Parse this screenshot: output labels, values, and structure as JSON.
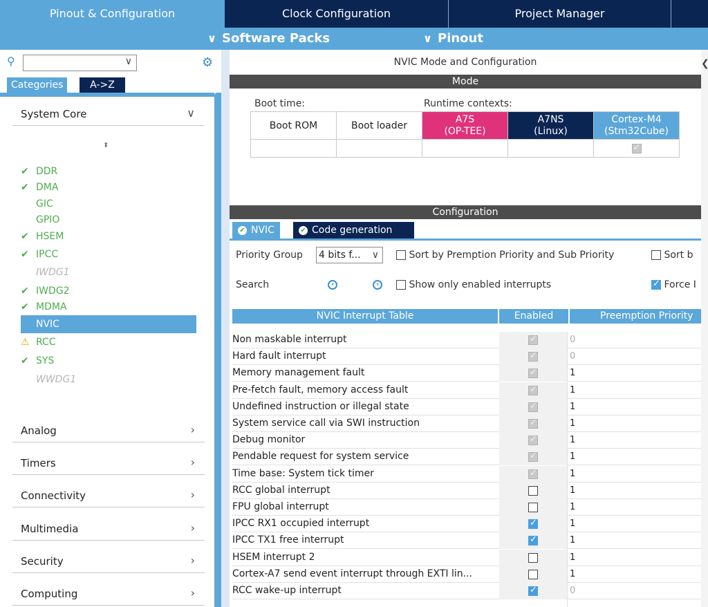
{
  "top_tabs": [
    "Pinout & Configuration",
    "Clock Configuration",
    "Project Manager"
  ],
  "sub_menu": [
    "Software Packs",
    "Pinout"
  ],
  "left": {
    "search_value": "",
    "tabs": [
      "Categories",
      "A->Z"
    ],
    "system_core": "System Core",
    "items": [
      {
        "label": "DDR",
        "state": "ok"
      },
      {
        "label": "DMA",
        "state": "ok"
      },
      {
        "label": "GIC",
        "state": "plain"
      },
      {
        "label": "GPIO",
        "state": "plain"
      },
      {
        "label": "HSEM",
        "state": "ok"
      },
      {
        "label": "IPCC",
        "state": "ok"
      },
      {
        "label": "IWDG1",
        "state": "disabled"
      },
      {
        "label": "IWDG2",
        "state": "ok"
      },
      {
        "label": "MDMA",
        "state": "ok"
      },
      {
        "label": "NVIC",
        "state": "selected"
      },
      {
        "label": "RCC",
        "state": "warning"
      },
      {
        "label": "SYS",
        "state": "ok"
      },
      {
        "label": "WWDG1",
        "state": "disabled"
      }
    ],
    "sections": [
      "Analog",
      "Timers",
      "Connectivity",
      "Multimedia",
      "Security",
      "Computing"
    ]
  },
  "right": {
    "title": "NVIC Mode and Configuration",
    "mode_bar": "Mode",
    "boot_time": "Boot time:",
    "runtime_contexts": "Runtime contexts:",
    "boot_rom": "Boot ROM",
    "boot_loader": "Boot loader",
    "a7s": "A7S",
    "a7s_sub": "(OP-TEE)",
    "a7ns": "A7NS",
    "a7ns_sub": "(Linux)",
    "m4": "Cortex-M4",
    "m4_sub": "(Stm32Cube)",
    "config_bar": "Configuration",
    "tab_nvic": "NVIC",
    "tab_codegen": "Code generation",
    "priority_group_label": "Priority Group",
    "priority_group_value": "4 bits f...",
    "sort_label": "Sort by Premption Priority and Sub Priority",
    "sort2_label": "Sort b",
    "search_label": "Search",
    "show_enabled_label": "Show only enabled interrupts",
    "force_label": "Force I",
    "col_table": "NVIC Interrupt Table",
    "col_enabled": "Enabled",
    "col_preempt": "Preemption Priority",
    "rows": [
      {
        "name": "Non maskable interrupt",
        "enabled": "dis",
        "prio": "0",
        "prio_dis": true
      },
      {
        "name": "Hard fault interrupt",
        "enabled": "dis",
        "prio": "0",
        "prio_dis": true
      },
      {
        "name": "Memory management fault",
        "enabled": "dis",
        "prio": "1",
        "prio_dis": false
      },
      {
        "name": "Pre-fetch fault, memory access fault",
        "enabled": "dis",
        "prio": "1",
        "prio_dis": false
      },
      {
        "name": "Undefined instruction or illegal state",
        "enabled": "dis",
        "prio": "1",
        "prio_dis": false
      },
      {
        "name": "System service call via SWI instruction",
        "enabled": "dis",
        "prio": "1",
        "prio_dis": false
      },
      {
        "name": "Debug monitor",
        "enabled": "dis",
        "prio": "1",
        "prio_dis": false
      },
      {
        "name": "Pendable request for system service",
        "enabled": "dis",
        "prio": "1",
        "prio_dis": false
      },
      {
        "name": "Time base: System tick timer",
        "enabled": "dis",
        "prio": "1",
        "prio_dis": false
      },
      {
        "name": "RCC global interrupt",
        "enabled": "off",
        "prio": "1",
        "prio_dis": false
      },
      {
        "name": "FPU global interrupt",
        "enabled": "off",
        "prio": "1",
        "prio_dis": false
      },
      {
        "name": "IPCC RX1 occupied interrupt",
        "enabled": "on",
        "prio": "1",
        "prio_dis": false
      },
      {
        "name": "IPCC TX1 free interrupt",
        "enabled": "on",
        "prio": "1",
        "prio_dis": false
      },
      {
        "name": "HSEM interrupt 2",
        "enabled": "off",
        "prio": "1",
        "prio_dis": false
      },
      {
        "name": "Cortex-A7 send event interrupt through EXTI lin...",
        "enabled": "off",
        "prio": "1",
        "prio_dis": false
      },
      {
        "name": "RCC wake-up interrupt",
        "enabled": "on",
        "prio": "0",
        "prio_dis": true
      }
    ]
  },
  "colors": {
    "accent": "#5ba7da",
    "navy": "#0b2553",
    "ok": "#4cae4c",
    "a7s": "#e0327a",
    "warn": "#e6a800"
  }
}
